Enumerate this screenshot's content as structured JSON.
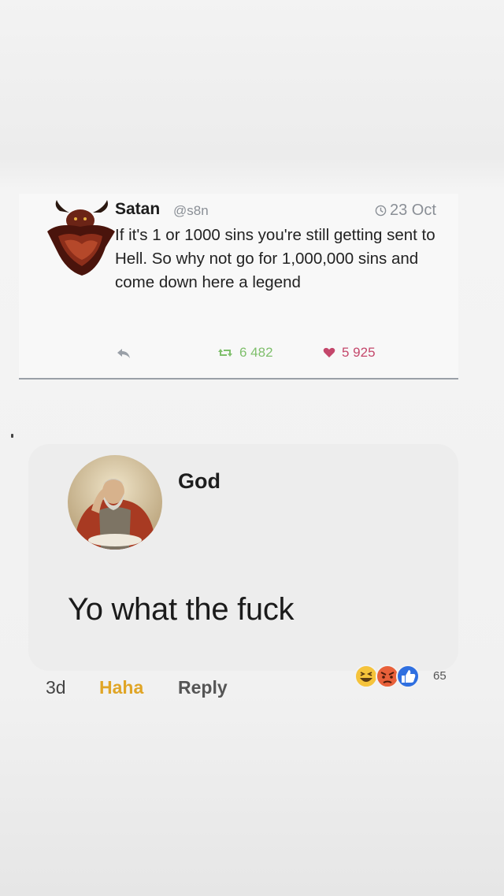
{
  "tweet": {
    "author": "Satan",
    "handle": "@s8n",
    "date": "23 Oct",
    "text": "If it's 1 or 1000 sins you're still getting sent to Hell. So why not go for 1,000,000 sins and come down here a legend",
    "retweets": "6 482",
    "likes": "5 925",
    "icons": [
      "satan-avatar",
      "clock-icon",
      "reply-icon",
      "retweet-icon",
      "heart-icon"
    ]
  },
  "comment": {
    "author": "God",
    "text": "Yo what the fuck",
    "time": "3d",
    "reaction_label": "Haha",
    "reply_label": "Reply",
    "reaction_count": "65",
    "reactions": [
      "haha-emoji",
      "angry-emoji",
      "like-icon"
    ]
  },
  "colors": {
    "retweet": "#7fbf6c",
    "like": "#c4476b",
    "haha": "#e0a526",
    "like_blue": "#2f6fe0"
  }
}
